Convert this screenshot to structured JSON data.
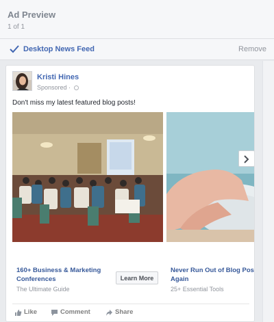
{
  "header": {
    "title": "Ad Preview",
    "pager": "1 of 1"
  },
  "placement": {
    "label": "Desktop News Feed",
    "remove_label": "Remove"
  },
  "post": {
    "poster_name": "Kristi Hines",
    "sponsored_label": "Sponsored",
    "message": "Don't miss my latest featured blog posts!"
  },
  "carousel": {
    "cards": [
      {
        "title_lines": [
          "160+ Business & Marketing",
          "Conferences"
        ],
        "subtitle": "The Ultimate Guide",
        "cta": "Learn More"
      },
      {
        "title_lines": [
          "Never Run Out of Blog Post Id",
          "Again"
        ],
        "subtitle": "25+ Essential Tools"
      }
    ]
  },
  "actions": {
    "like": "Like",
    "comment": "Comment",
    "share": "Share"
  },
  "colors": {
    "link": "#4267b2",
    "muted": "#90949c",
    "panel": "#f6f7f9"
  }
}
